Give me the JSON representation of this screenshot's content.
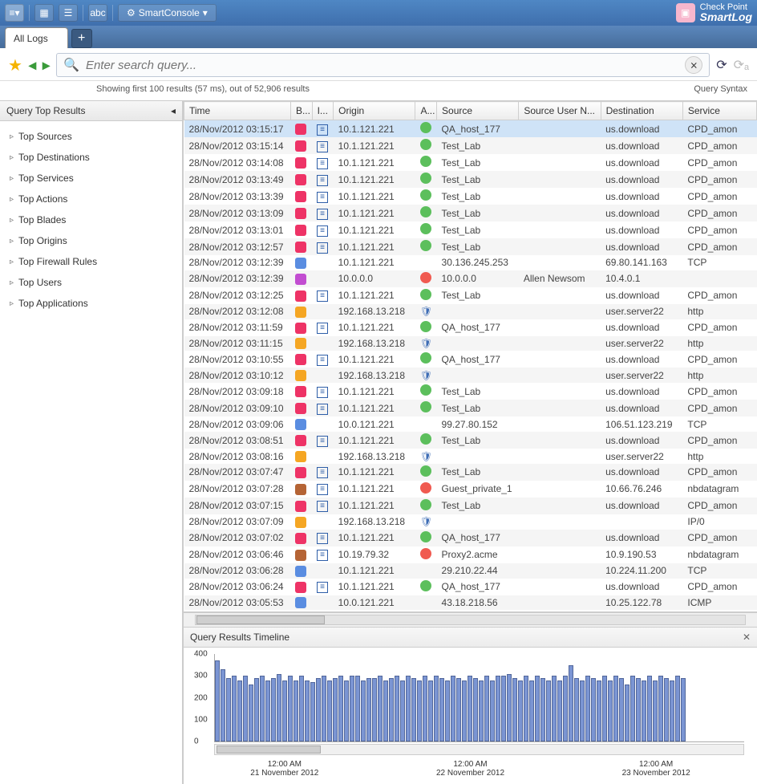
{
  "brand": {
    "line1": "Check Point",
    "line2": "SmartLog"
  },
  "titlebar": {
    "smartconsole_label": "SmartConsole",
    "abc_label": "abc"
  },
  "tabs": {
    "active": "All Logs"
  },
  "search": {
    "placeholder": "Enter search query..."
  },
  "info": {
    "status": "Showing first 100 results (57 ms), out of 52,906 results",
    "query_syntax": "Query Syntax"
  },
  "sidebar": {
    "title": "Query Top Results",
    "items": [
      "Top Sources",
      "Top Destinations",
      "Top Services",
      "Top Actions",
      "Top Blades",
      "Top Origins",
      "Top Firewall Rules",
      "Top Users",
      "Top Applications"
    ]
  },
  "columns": [
    "Time",
    "B...",
    "I...",
    "Origin",
    "A...",
    "Source",
    "Source User N...",
    "Destination",
    "Service"
  ],
  "rows": [
    {
      "time": "28/Nov/2012 03:15:17",
      "b": "fw",
      "i": 1,
      "origin": "10.1.121.221",
      "a": "accept",
      "source": "QA_host_177",
      "user": "",
      "dest": "us.download",
      "service": "CPD_amon",
      "sel": true
    },
    {
      "time": "28/Nov/2012 03:15:14",
      "b": "fw",
      "i": 1,
      "origin": "10.1.121.221",
      "a": "accept",
      "source": "Test_Lab",
      "user": "",
      "dest": "us.download",
      "service": "CPD_amon"
    },
    {
      "time": "28/Nov/2012 03:14:08",
      "b": "fw",
      "i": 1,
      "origin": "10.1.121.221",
      "a": "accept",
      "source": "Test_Lab",
      "user": "",
      "dest": "us.download",
      "service": "CPD_amon"
    },
    {
      "time": "28/Nov/2012 03:13:49",
      "b": "fw",
      "i": 1,
      "origin": "10.1.121.221",
      "a": "accept",
      "source": "Test_Lab",
      "user": "",
      "dest": "us.download",
      "service": "CPD_amon"
    },
    {
      "time": "28/Nov/2012 03:13:39",
      "b": "fw",
      "i": 1,
      "origin": "10.1.121.221",
      "a": "accept",
      "source": "Test_Lab",
      "user": "",
      "dest": "us.download",
      "service": "CPD_amon"
    },
    {
      "time": "28/Nov/2012 03:13:09",
      "b": "fw",
      "i": 1,
      "origin": "10.1.121.221",
      "a": "accept",
      "source": "Test_Lab",
      "user": "",
      "dest": "us.download",
      "service": "CPD_amon"
    },
    {
      "time": "28/Nov/2012 03:13:01",
      "b": "fw",
      "i": 1,
      "origin": "10.1.121.221",
      "a": "accept",
      "source": "Test_Lab",
      "user": "",
      "dest": "us.download",
      "service": "CPD_amon"
    },
    {
      "time": "28/Nov/2012 03:12:57",
      "b": "fw",
      "i": 1,
      "origin": "10.1.121.221",
      "a": "accept",
      "source": "Test_Lab",
      "user": "",
      "dest": "us.download",
      "service": "CPD_amon"
    },
    {
      "time": "28/Nov/2012 03:12:39",
      "b": "ips",
      "i": 0,
      "origin": "10.1.121.221",
      "a": "",
      "source": "30.136.245.253",
      "user": "",
      "dest": "69.80.141.163",
      "service": "TCP"
    },
    {
      "time": "28/Nov/2012 03:12:39",
      "b": "app",
      "i": 0,
      "origin": "10.0.0.0",
      "a": "drop",
      "source": "10.0.0.0",
      "user": "Allen Newsom",
      "dest": "10.4.0.1",
      "service": ""
    },
    {
      "time": "28/Nov/2012 03:12:25",
      "b": "fw",
      "i": 1,
      "origin": "10.1.121.221",
      "a": "accept",
      "source": "Test_Lab",
      "user": "",
      "dest": "us.download",
      "service": "CPD_amon"
    },
    {
      "time": "28/Nov/2012 03:12:08",
      "b": "av",
      "i": 0,
      "origin": "192.168.13.218",
      "a": "detect",
      "source": "",
      "user": "",
      "dest": "user.server22",
      "service": "http"
    },
    {
      "time": "28/Nov/2012 03:11:59",
      "b": "fw",
      "i": 1,
      "origin": "10.1.121.221",
      "a": "accept",
      "source": "QA_host_177",
      "user": "",
      "dest": "us.download",
      "service": "CPD_amon"
    },
    {
      "time": "28/Nov/2012 03:11:15",
      "b": "av",
      "i": 0,
      "origin": "192.168.13.218",
      "a": "detect",
      "source": "",
      "user": "",
      "dest": "user.server22",
      "service": "http"
    },
    {
      "time": "28/Nov/2012 03:10:55",
      "b": "fw",
      "i": 1,
      "origin": "10.1.121.221",
      "a": "accept",
      "source": "QA_host_177",
      "user": "",
      "dest": "us.download",
      "service": "CPD_amon"
    },
    {
      "time": "28/Nov/2012 03:10:12",
      "b": "av",
      "i": 0,
      "origin": "192.168.13.218",
      "a": "detect",
      "source": "",
      "user": "",
      "dest": "user.server22",
      "service": "http"
    },
    {
      "time": "28/Nov/2012 03:09:18",
      "b": "fw",
      "i": 1,
      "origin": "10.1.121.221",
      "a": "accept",
      "source": "Test_Lab",
      "user": "",
      "dest": "us.download",
      "service": "CPD_amon"
    },
    {
      "time": "28/Nov/2012 03:09:10",
      "b": "fw",
      "i": 1,
      "origin": "10.1.121.221",
      "a": "accept",
      "source": "Test_Lab",
      "user": "",
      "dest": "us.download",
      "service": "CPD_amon"
    },
    {
      "time": "28/Nov/2012 03:09:06",
      "b": "ips",
      "i": 0,
      "origin": "10.0.121.221",
      "a": "",
      "source": "99.27.80.152",
      "user": "",
      "dest": "106.51.123.219",
      "service": "TCP"
    },
    {
      "time": "28/Nov/2012 03:08:51",
      "b": "fw",
      "i": 1,
      "origin": "10.1.121.221",
      "a": "accept",
      "source": "Test_Lab",
      "user": "",
      "dest": "us.download",
      "service": "CPD_amon"
    },
    {
      "time": "28/Nov/2012 03:08:16",
      "b": "av",
      "i": 0,
      "origin": "192.168.13.218",
      "a": "detect",
      "source": "",
      "user": "",
      "dest": "user.server22",
      "service": "http"
    },
    {
      "time": "28/Nov/2012 03:07:47",
      "b": "fw",
      "i": 1,
      "origin": "10.1.121.221",
      "a": "accept",
      "source": "Test_Lab",
      "user": "",
      "dest": "us.download",
      "service": "CPD_amon"
    },
    {
      "time": "28/Nov/2012 03:07:28",
      "b": "th",
      "i": 1,
      "origin": "10.1.121.221",
      "a": "drop",
      "source": "Guest_private_1",
      "user": "",
      "dest": "10.66.76.246",
      "service": "nbdatagram"
    },
    {
      "time": "28/Nov/2012 03:07:15",
      "b": "fw",
      "i": 1,
      "origin": "10.1.121.221",
      "a": "accept",
      "source": "Test_Lab",
      "user": "",
      "dest": "us.download",
      "service": "CPD_amon"
    },
    {
      "time": "28/Nov/2012 03:07:09",
      "b": "av",
      "i": 0,
      "origin": "192.168.13.218",
      "a": "detect",
      "source": "",
      "user": "",
      "dest": "",
      "service": "IP/0"
    },
    {
      "time": "28/Nov/2012 03:07:02",
      "b": "fw",
      "i": 1,
      "origin": "10.1.121.221",
      "a": "accept",
      "source": "QA_host_177",
      "user": "",
      "dest": "us.download",
      "service": "CPD_amon"
    },
    {
      "time": "28/Nov/2012 03:06:46",
      "b": "th",
      "i": 1,
      "origin": "10.19.79.32",
      "a": "drop",
      "source": "Proxy2.acme",
      "user": "",
      "dest": "10.9.190.53",
      "service": "nbdatagram"
    },
    {
      "time": "28/Nov/2012 03:06:28",
      "b": "ips",
      "i": 0,
      "origin": "10.1.121.221",
      "a": "",
      "source": "29.210.22.44",
      "user": "",
      "dest": "10.224.11.200",
      "service": "TCP"
    },
    {
      "time": "28/Nov/2012 03:06:24",
      "b": "fw",
      "i": 1,
      "origin": "10.1.121.221",
      "a": "accept",
      "source": "QA_host_177",
      "user": "",
      "dest": "us.download",
      "service": "CPD_amon"
    },
    {
      "time": "28/Nov/2012 03:05:53",
      "b": "ips",
      "i": 0,
      "origin": "10.0.121.221",
      "a": "",
      "source": "43.18.218.56",
      "user": "",
      "dest": "10.25.122.78",
      "service": "ICMP"
    }
  ],
  "timeline": {
    "title": "Query Results Timeline",
    "xaxis": [
      {
        "time": "12:00 AM",
        "date": "21 November 2012"
      },
      {
        "time": "12:00 AM",
        "date": "22 November 2012"
      },
      {
        "time": "12:00 AM",
        "date": "23 November 2012"
      }
    ]
  },
  "chart_data": {
    "type": "bar",
    "title": "Query Results Timeline",
    "ylabel": "",
    "ylim": [
      0,
      400
    ],
    "yticks": [
      0,
      100,
      200,
      300,
      400
    ],
    "x_range": [
      "21 November 2012 00:00",
      "23 November 2012 23:59"
    ],
    "note": "Approximate result counts per time bucket read from chart; ~84 buckets spanning 21–23 Nov 2012",
    "values": [
      370,
      330,
      290,
      300,
      280,
      300,
      260,
      290,
      300,
      280,
      290,
      310,
      280,
      300,
      280,
      300,
      280,
      270,
      290,
      300,
      280,
      290,
      300,
      280,
      300,
      300,
      280,
      290,
      290,
      300,
      280,
      290,
      300,
      280,
      300,
      290,
      280,
      300,
      280,
      300,
      290,
      280,
      300,
      290,
      280,
      300,
      290,
      280,
      300,
      280,
      300,
      300,
      310,
      290,
      280,
      300,
      280,
      300,
      290,
      280,
      300,
      280,
      300,
      350,
      290,
      280,
      300,
      290,
      280,
      300,
      280,
      300,
      290,
      260,
      300,
      290,
      280,
      300,
      280,
      300,
      290,
      280,
      300,
      290
    ]
  }
}
